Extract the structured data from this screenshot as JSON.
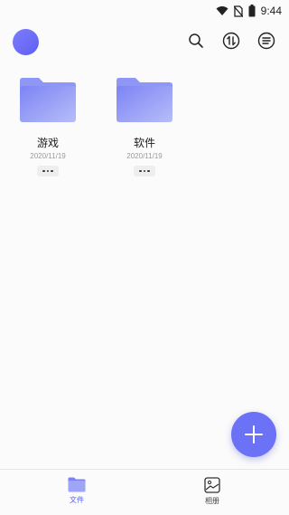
{
  "status_bar": {
    "time": "9:44",
    "icons": [
      "wifi-icon",
      "no-sim-icon",
      "battery-icon"
    ]
  },
  "header": {
    "avatar_color": "#6b6bff",
    "actions": [
      "search-icon",
      "sort-icon",
      "menu-list-icon"
    ]
  },
  "folders": [
    {
      "name": "游戏",
      "date": "2020/11/19",
      "more": "more-options"
    },
    {
      "name": "软件",
      "date": "2020/11/19",
      "more": "more-options"
    }
  ],
  "fab": {
    "icon": "plus-icon",
    "color": "#6b72f5"
  },
  "bottom_nav": {
    "items": [
      {
        "label": "文件",
        "icon": "folder-icon",
        "active": true
      },
      {
        "label": "相册",
        "icon": "photo-album-icon",
        "active": false
      }
    ],
    "active_color": "#5b63e8"
  }
}
